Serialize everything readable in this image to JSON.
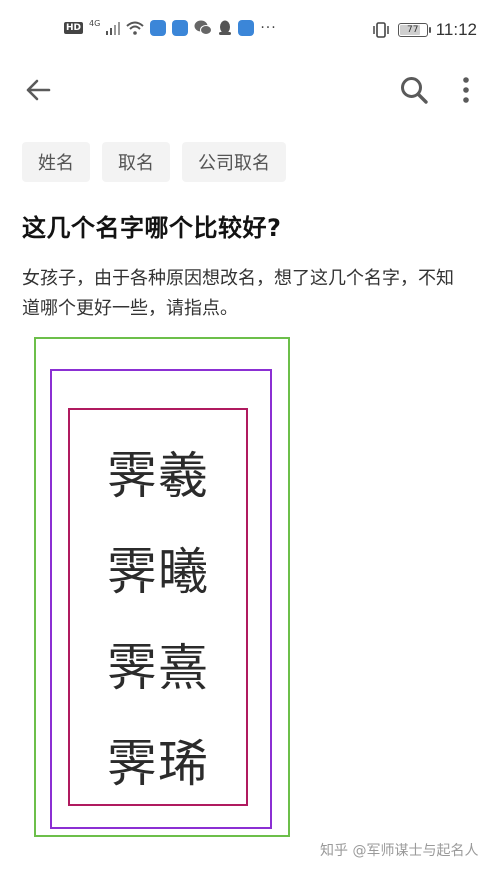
{
  "status_bar": {
    "hd": "HD",
    "network": "4G",
    "more": "···",
    "battery": "77",
    "battery_level": 0.77,
    "time": "11:12"
  },
  "toolbar": {
    "back_icon": "arrow-left-icon",
    "search_icon": "search-icon",
    "more_icon": "more-vertical-icon"
  },
  "tags": [
    {
      "label": "姓名"
    },
    {
      "label": "取名"
    },
    {
      "label": "公司取名"
    }
  ],
  "question": {
    "title": "这几个名字哪个比较好?",
    "body": "女孩子，由于各种原因想改名，想了这几个名字，不知道哪个更好一些，请指点。"
  },
  "image": {
    "names": [
      "霁羲",
      "霁曦",
      "霁熹",
      "霁琋"
    ],
    "frame_colors": [
      "#6cbf4a",
      "#8b2fd3",
      "#b01a5f"
    ]
  },
  "watermark": "知乎 @军师谋士与起名人"
}
